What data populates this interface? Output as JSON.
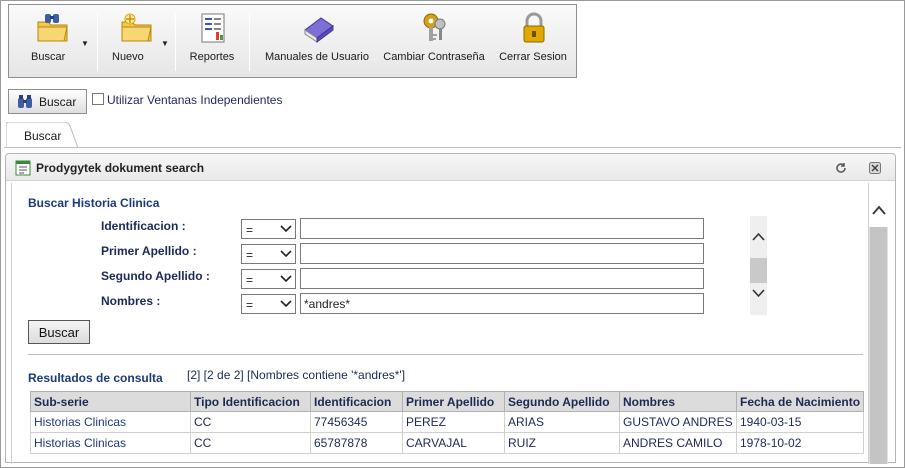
{
  "toolbar": {
    "items": [
      {
        "label": "Buscar",
        "icon": "folder-binoculars-icon"
      },
      {
        "label": "Nuevo",
        "icon": "folder-new-icon"
      },
      {
        "label": "Reportes",
        "icon": "report-icon"
      },
      {
        "label": "Manuales de Usuario",
        "icon": "book-icon"
      },
      {
        "label": "Cambiar Contraseña",
        "icon": "keys-icon"
      },
      {
        "label": "Cerrar Sesion",
        "icon": "lock-icon"
      }
    ]
  },
  "searchbar": {
    "button_label": "Buscar",
    "checkbox_label": "Utilizar Ventanas Independientes",
    "checkbox_checked": false
  },
  "tabs": [
    {
      "label": "Buscar"
    }
  ],
  "panel": {
    "title": "Prodygytek dokument search",
    "form": {
      "title": "Buscar Historia Clinica",
      "fields": [
        {
          "label": "Identificacion :",
          "operator": "=",
          "value": ""
        },
        {
          "label": "Primer Apellido :",
          "operator": "=",
          "value": ""
        },
        {
          "label": "Segundo Apellido :",
          "operator": "=",
          "value": ""
        },
        {
          "label": "Nombres :",
          "operator": "=",
          "value": "*andres*"
        }
      ],
      "submit_label": "Buscar"
    },
    "results": {
      "title": "Resultados de consulta",
      "summary": "[2] [2 de 2] [Nombres contiene '*andres*']",
      "columns": [
        "Sub-serie",
        "Tipo Identificacion",
        "Identificacion",
        "Primer Apellido",
        "Segundo Apellido",
        "Nombres",
        "Fecha de Nacimiento"
      ],
      "rows": [
        [
          "Historias Clinicas",
          "CC",
          "77456345",
          "PEREZ",
          "ARIAS",
          "GUSTAVO ANDRES",
          "1940-03-15"
        ],
        [
          "Historias Clinicas",
          "CC",
          "65787878",
          "CARVAJAL",
          "RUIZ",
          "ANDRES CAMILO",
          "1978-10-02"
        ]
      ]
    }
  },
  "colors": {
    "text_navy": "#1b2a55",
    "header_gray": "#dcdcdc",
    "toolbar_bg": "#eeeeee"
  }
}
